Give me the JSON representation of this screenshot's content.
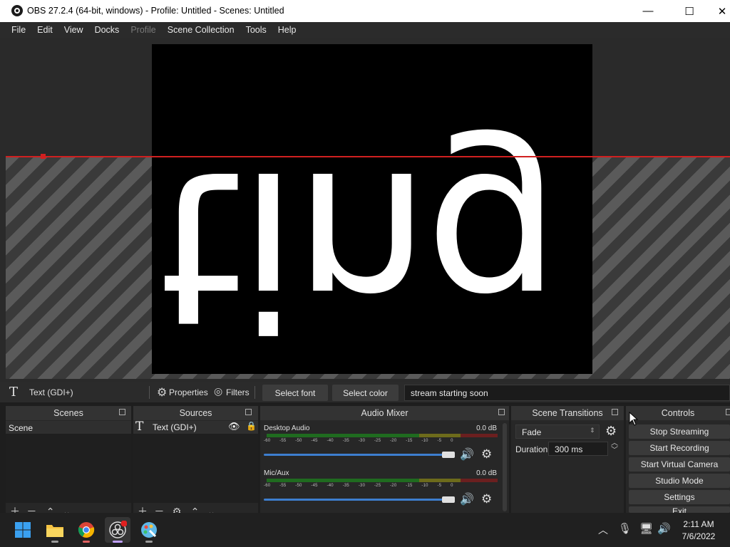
{
  "window": {
    "title": "OBS 27.2.4 (64-bit, windows) - Profile: Untitled - Scenes: Untitled",
    "minimize": "—",
    "maximize": "☐",
    "close": "✕"
  },
  "menu": [
    "File",
    "Edit",
    "View",
    "Docks",
    "Profile",
    "Scene Collection",
    "Tools",
    "Help"
  ],
  "preview": {
    "canvas_text": "ting a"
  },
  "source_toolbar": {
    "source_name": "Text (GDI+)",
    "properties_label": "Properties",
    "filters_label": "Filters",
    "select_font_label": "Select font",
    "select_color_label": "Select color",
    "text_value": "stream starting soon"
  },
  "docks": {
    "scenes": {
      "title": "Scenes",
      "items": [
        "Scene"
      ]
    },
    "sources": {
      "title": "Sources",
      "items": [
        "Text (GDI+)"
      ]
    },
    "audio_mixer": {
      "title": "Audio Mixer",
      "channels": [
        {
          "name": "Desktop Audio",
          "level": "0.0 dB",
          "volume": 1.0
        },
        {
          "name": "Mic/Aux",
          "level": "0.0 dB",
          "volume": 1.0
        }
      ],
      "ticks": "-60 -55 -50 -45 -40 -35 -30 -25 -20 -15 -10 -5 0"
    },
    "scene_transitions": {
      "title": "Scene Transitions",
      "transition": "Fade",
      "duration_label": "Duration",
      "duration_value": "300 ms"
    },
    "controls": {
      "title": "Controls",
      "buttons": [
        "Stop Streaming",
        "Start Recording",
        "Start Virtual Camera",
        "Studio Mode",
        "Settings",
        "Exit"
      ]
    }
  },
  "taskbar": {
    "time": "2:11 AM",
    "date": "7/6/2022"
  },
  "colors": {
    "accent": "#3d7ecf",
    "guide_line": "#d02020"
  }
}
